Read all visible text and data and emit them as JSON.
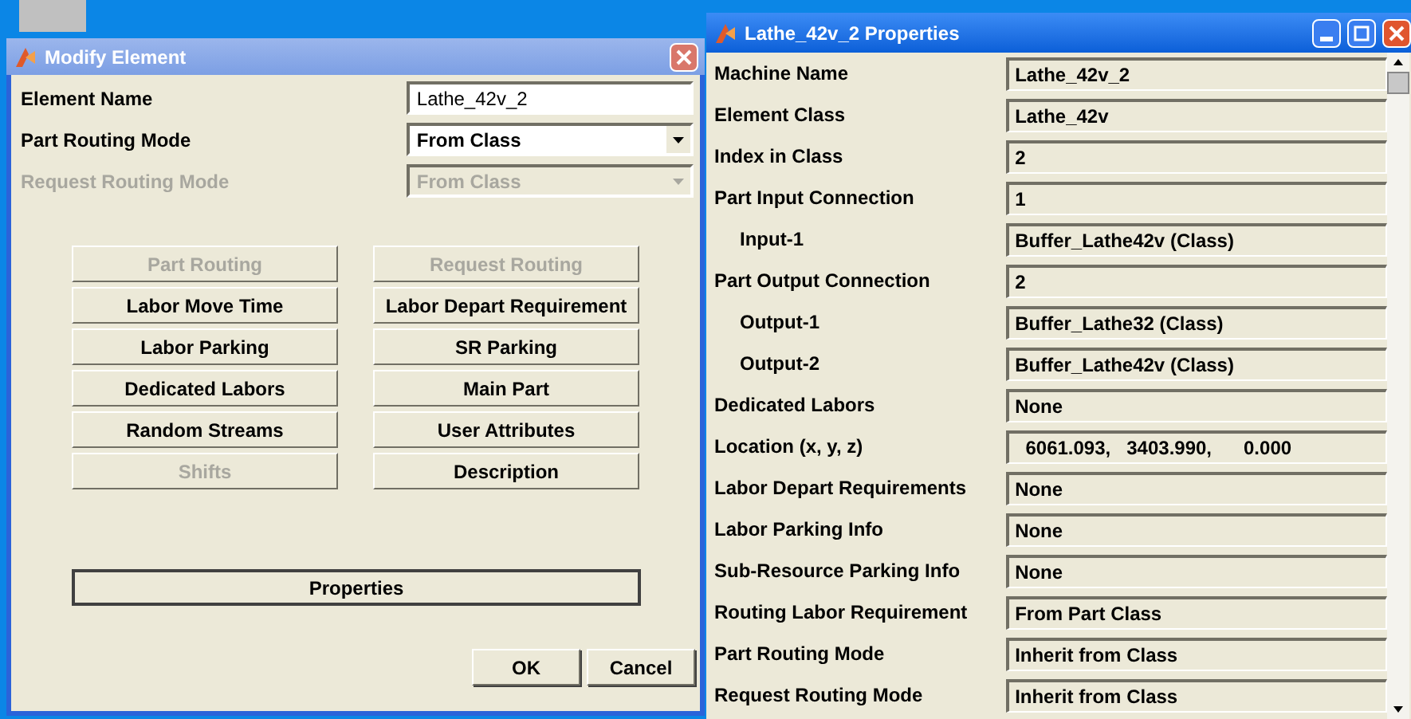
{
  "modify_window": {
    "title": "Modify Element",
    "fields": [
      {
        "label": "Element Name",
        "kind": "text",
        "value": "Lathe_42v_2",
        "disabled": false
      },
      {
        "label": "Part Routing Mode",
        "kind": "dropdown",
        "value": "From Class",
        "disabled": false
      },
      {
        "label": "Request Routing Mode",
        "kind": "dropdown",
        "value": "From Class",
        "disabled": true
      }
    ],
    "buttons": [
      {
        "label": "Part Routing",
        "disabled": true
      },
      {
        "label": "Request Routing",
        "disabled": true
      },
      {
        "label": "Labor Move Time",
        "disabled": false
      },
      {
        "label": "Labor Depart Requirement",
        "disabled": false
      },
      {
        "label": "Labor Parking",
        "disabled": false
      },
      {
        "label": "SR Parking",
        "disabled": false
      },
      {
        "label": "Dedicated Labors",
        "disabled": false
      },
      {
        "label": "Main Part",
        "disabled": false
      },
      {
        "label": "Random Streams",
        "disabled": false
      },
      {
        "label": "User Attributes",
        "disabled": false
      },
      {
        "label": "Shifts",
        "disabled": true
      },
      {
        "label": "Description",
        "disabled": false
      }
    ],
    "properties_button": "Properties",
    "ok_button": "OK",
    "cancel_button": "Cancel"
  },
  "properties_window": {
    "title": "Lathe_42v_2 Properties",
    "rows": [
      {
        "label": "Machine Name",
        "value": "Lathe_42v_2",
        "indented": false
      },
      {
        "label": "Element Class",
        "value": "Lathe_42v",
        "indented": false
      },
      {
        "label": "Index in Class",
        "value": "2",
        "indented": false
      },
      {
        "label": "Part Input Connection",
        "value": "1",
        "indented": false
      },
      {
        "label": "Input-1",
        "value": "Buffer_Lathe42v (Class)",
        "indented": true
      },
      {
        "label": "Part Output Connection",
        "value": "2",
        "indented": false
      },
      {
        "label": "Output-1",
        "value": "Buffer_Lathe32 (Class)",
        "indented": true
      },
      {
        "label": "Output-2",
        "value": "Buffer_Lathe42v (Class)",
        "indented": true
      },
      {
        "label": "Dedicated Labors",
        "value": "None",
        "indented": false
      },
      {
        "label": "Location (x, y, z)",
        "value": "  6061.093,   3403.990,      0.000",
        "indented": false
      },
      {
        "label": "Labor Depart Requirements",
        "value": "None",
        "indented": false
      },
      {
        "label": "Labor Parking Info",
        "value": "None",
        "indented": false
      },
      {
        "label": "Sub-Resource Parking Info",
        "value": "None",
        "indented": false
      },
      {
        "label": "Routing Labor Requirement",
        "value": "From Part Class",
        "indented": false
      },
      {
        "label": "Part Routing Mode",
        "value": "Inherit from Class",
        "indented": false
      },
      {
        "label": "Request Routing Mode",
        "value": "Inherit from Class",
        "indented": false
      }
    ]
  }
}
